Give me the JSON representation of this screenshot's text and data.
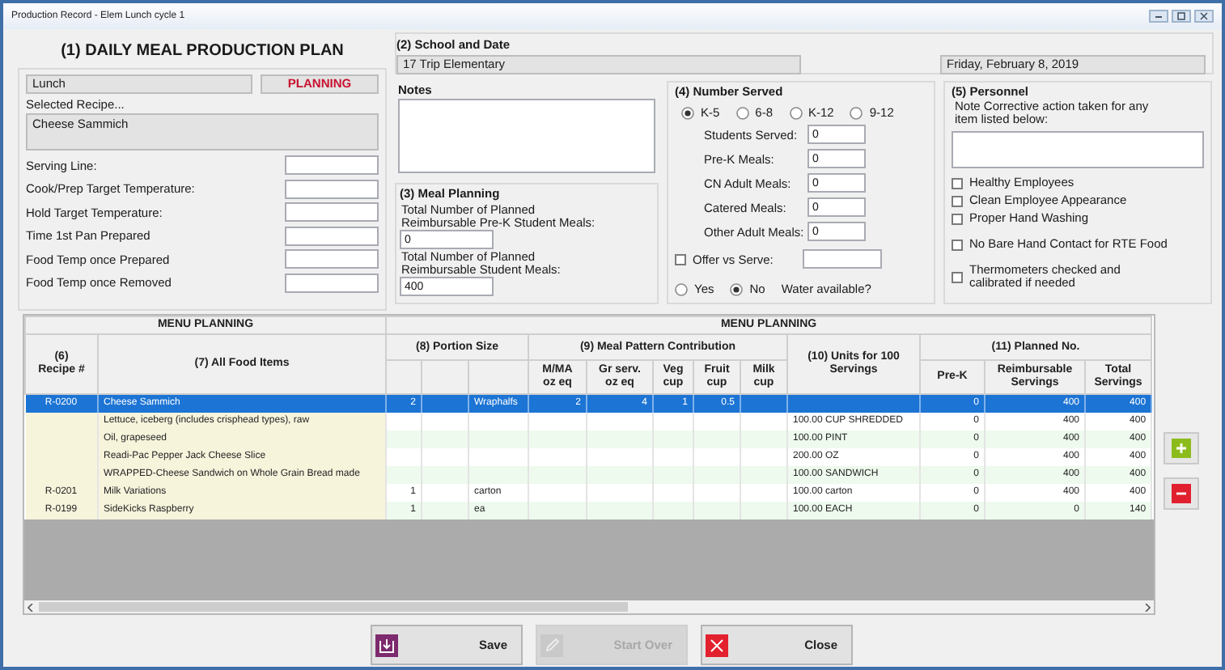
{
  "window": {
    "title": "Production Record - Elem Lunch cycle 1"
  },
  "plan": {
    "title": "(1) DAILY MEAL PRODUCTION PLAN",
    "meal": "Lunch",
    "status": "PLANNING",
    "recipe_label": "Selected Recipe...",
    "recipe": "Cheese Sammich",
    "fields": [
      {
        "label": "Serving Line:"
      },
      {
        "label": "Cook/Prep Target Temperature:"
      },
      {
        "label": "Hold Target Temperature:"
      },
      {
        "label": "Time 1st Pan Prepared"
      },
      {
        "label": "Food Temp once Prepared"
      },
      {
        "label": "Food Temp once Removed"
      }
    ]
  },
  "school_and_date": {
    "title": "(2) School and Date",
    "school": "17 Trip Elementary",
    "date": "Friday, February 8, 2019"
  },
  "notes": {
    "title": "Notes"
  },
  "meal_planning": {
    "title": "(3) Meal Planning",
    "fields": [
      {
        "label": "Total Number of Planned\nReimbursable Pre-K Student Meals:",
        "value": "0"
      },
      {
        "label": "Total Number of Planned\nReimbursable Student Meals:",
        "value": "400"
      }
    ]
  },
  "number_served": {
    "title": "(4) Number Served",
    "grades": [
      {
        "label": "K-5",
        "selected": true
      },
      {
        "label": "6-8",
        "selected": false
      },
      {
        "label": "K-12",
        "selected": false
      },
      {
        "label": "9-12",
        "selected": false
      }
    ],
    "counts": [
      {
        "label": "Students Served:",
        "value": "0"
      },
      {
        "label": "Pre-K Meals:",
        "value": "0"
      },
      {
        "label": "CN Adult Meals:",
        "value": "0"
      },
      {
        "label": "Catered Meals:",
        "value": "0"
      },
      {
        "label": "Other Adult Meals:",
        "value": "0"
      }
    ],
    "offer_vs_serve": {
      "label": "Offer vs Serve:",
      "checked": false
    },
    "water": {
      "options": [
        {
          "label": "Yes",
          "selected": false
        },
        {
          "label": "No",
          "selected": true
        }
      ],
      "label": "Water available?"
    }
  },
  "personnel": {
    "title": "(5) Personnel",
    "instruction": "Note Corrective action taken for any item listed below:",
    "checks": [
      {
        "label": "Healthy Employees",
        "checked": false
      },
      {
        "label": "Clean Employee Appearance",
        "checked": false
      },
      {
        "label": "Proper Hand Washing",
        "checked": false
      },
      {
        "label": "No Bare Hand Contact for RTE Food",
        "checked": false
      },
      {
        "label": "Thermometers checked and\ncalibrated if needed",
        "checked": false
      }
    ]
  },
  "menu_table": {
    "sections": [
      {
        "title": "MENU PLANNING"
      },
      {
        "title": "MENU PLANNING"
      }
    ],
    "headers": {
      "recipe": "(6)\nRecipe #",
      "food_item": "(7) All Food Items",
      "portion": "(8) Portion Size",
      "meal_pattern": "(9) Meal Pattern Contribution",
      "mma": "M/MA\noz eq",
      "grain": "Gr serv.\noz eq",
      "veg": "Veg\ncup",
      "fruit": "Fruit\ncup",
      "milk": "Milk\ncup",
      "units": "(10) Units for 100\nServings",
      "planned": "(11) Planned No.",
      "pre_k": "Pre-K",
      "reimbursable": "Reimbursable\nServings",
      "total": "Total\nServings"
    },
    "rows": [
      {
        "recipe": "R-0200",
        "food_item": "Cheese Sammich",
        "portion_qty": "2",
        "portion_unit": "Wraphalfs",
        "mma": "2",
        "grain": "4",
        "veg": "1",
        "fruit": "0.5",
        "pre_k": "0",
        "reimbursable": "400",
        "total": "400",
        "selected": true
      },
      {
        "food_item": "Lettuce, iceberg (includes crisphead types), raw",
        "units": "100.00 CUP SHREDDED",
        "pre_k": "0",
        "reimbursable": "400",
        "total": "400",
        "selected": false
      },
      {
        "food_item": "Oil, grapeseed",
        "units": "100.00 PINT",
        "pre_k": "0",
        "reimbursable": "400",
        "total": "400",
        "selected": false
      },
      {
        "food_item": "Readi-Pac Pepper Jack Cheese Slice",
        "units": "200.00 OZ",
        "pre_k": "0",
        "reimbursable": "400",
        "total": "400",
        "selected": false
      },
      {
        "food_item": "WRAPPED-Cheese Sandwich on Whole Grain Bread made",
        "units": "100.00 SANDWICH",
        "pre_k": "0",
        "reimbursable": "400",
        "total": "400",
        "selected": false
      },
      {
        "recipe": "R-0201",
        "food_item": "Milk Variations",
        "portion_qty": "1",
        "portion_unit": "carton",
        "units": "100.00 carton",
        "pre_k": "0",
        "reimbursable": "400",
        "total": "400",
        "selected": false
      },
      {
        "recipe": "R-0199",
        "food_item": "SideKicks Raspberry",
        "portion_qty": "1",
        "portion_unit": "ea",
        "units": "100.00 EACH",
        "pre_k": "0",
        "reimbursable": "0",
        "total": "140",
        "selected": false
      }
    ]
  },
  "actions": [
    {
      "label": "Save",
      "kind": "save",
      "disabled": false
    },
    {
      "label": "Start Over",
      "kind": "edit",
      "disabled": true
    },
    {
      "label": "Close",
      "kind": "close",
      "disabled": false
    }
  ]
}
